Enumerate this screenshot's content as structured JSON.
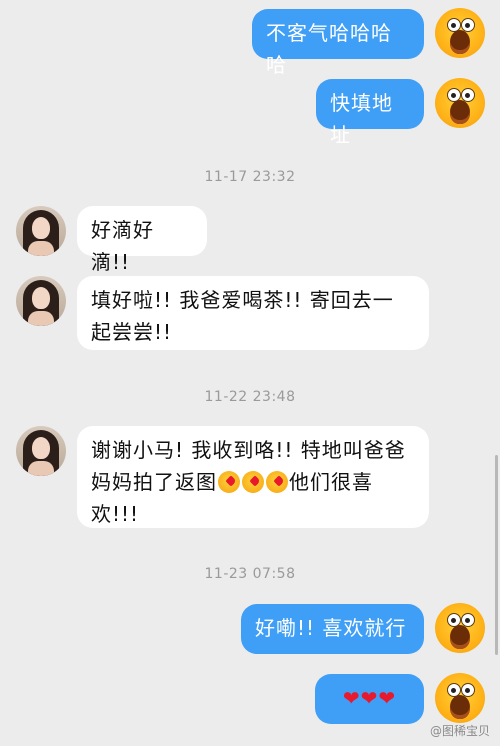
{
  "messages": [
    {
      "side": "me",
      "text": "不客气哈哈哈哈"
    },
    {
      "side": "me",
      "text": "快填地址"
    },
    {
      "timestamp": "11-17 23:32"
    },
    {
      "side": "her",
      "text": "好滴好滴!!"
    },
    {
      "side": "her",
      "line1": "填好啦!! 我爸爱喝茶!! 寄回去一",
      "line2": "起尝尝!!"
    },
    {
      "timestamp": "11-22 23:48"
    },
    {
      "side": "her",
      "line1": "谢谢小马! 我收到咯!! 特地叫爸爸",
      "line2a": "妈妈拍了返图",
      "line2b": "他们很喜",
      "line3": "欢!!!",
      "emoji": "kissing-face-icon"
    },
    {
      "timestamp": "11-23 07:58"
    },
    {
      "side": "me",
      "text": "好嘞!! 喜欢就行"
    },
    {
      "side": "me",
      "text": "❤❤❤",
      "icon": "heart-icon"
    }
  ],
  "watermark": "@图稀宝贝",
  "colors": {
    "my_bubble": "#3f9ef6",
    "their_bubble": "#ffffff",
    "background": "#ececed"
  }
}
